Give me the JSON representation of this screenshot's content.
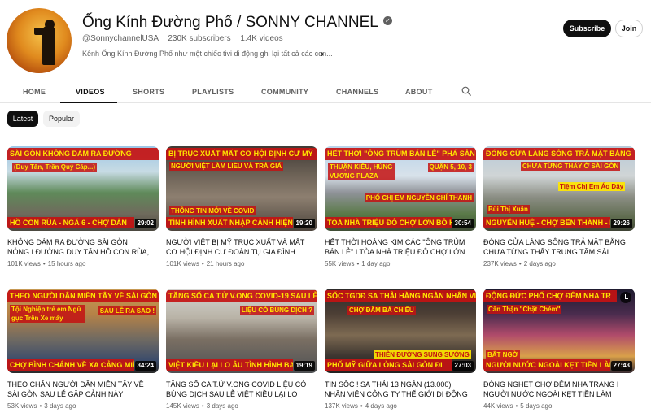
{
  "channel": {
    "name": "Ống Kính Đường Phố / SONNY CHANNEL",
    "handle": "@SonnychannelUSA",
    "subscribers": "230K subscribers",
    "videos_count": "1.4K videos",
    "description": "Kênh Ống Kính Đường Phố như một chiếc tivi di động ghi lại tất cả các con...",
    "subscribe_label": "Subscribe",
    "join_label": "Join"
  },
  "tabs": [
    {
      "label": "HOME"
    },
    {
      "label": "VIDEOS"
    },
    {
      "label": "SHORTS"
    },
    {
      "label": "PLAYLISTS"
    },
    {
      "label": "COMMUNITY"
    },
    {
      "label": "CHANNELS"
    },
    {
      "label": "ABOUT"
    }
  ],
  "filters": {
    "latest": "Latest",
    "popular": "Popular"
  },
  "videos": [
    {
      "thumb_top": "SÀI GÒN KHÔNG DÁM RA ĐƯỜNG",
      "thumb_sub": "(Duy Tân, Trần Quý Cáp...)",
      "thumb_bottom": "HỒ CON RÙA - NGÃ 6 - CHỢ DÂN",
      "duration": "29:02",
      "title": "KHÔNG DÁM RA ĐƯỜNG SÀI GÒN NÓNG I ĐƯỜNG DUY TÂN HỒ CON RÙA, TRẦN QUÝ...",
      "views": "101K views",
      "age": "15 hours ago"
    },
    {
      "thumb_top": "BỊ TRỤC XUẤT MẤT CƠ HỘI ĐỊNH CƯ MỸ",
      "thumb_sub": "NGƯỜI VIỆT LÀM LIỀU VÀ TRẢ GIÁ",
      "thumb_sub2": "THÔNG TIN MỚI VỀ COVID",
      "thumb_bottom": "TÌNH HÌNH XUẤT NHẬP CẢNH HIỆN",
      "duration": "19:20",
      "title": "NGƯỜI VIỆT BỊ MỸ TRỤC XUẤT VÀ MẤT CƠ HỘI ĐỊNH CƯ ĐOÀN TỤ GIA ĐÌNH",
      "views": "101K views",
      "age": "21 hours ago"
    },
    {
      "thumb_top": "HẾT THỜI \"ÔNG TRÙM BÁN LẺ\" PHÁ SẢN",
      "thumb_sub": "THUẬN KIỀU, HÙNG VƯƠNG PLAZA",
      "thumb_sub2": "QUẬN 5, 10, 3",
      "thumb_sub3": "PHỐ CHỊ EM NGUYỄN CHÍ THANH",
      "thumb_bottom": "TÒA NHÀ TRIỆU ĐÔ CHỢ LỚN BỎ H",
      "duration": "30:54",
      "title": "HẾT THỜI HOÀNG KIM CÁC \"ÔNG TRÙM BÁN LẺ\" I TÒA NHÀ TRIỆU ĐÔ CHỢ LỚN BỎ...",
      "views": "55K views",
      "age": "1 day ago"
    },
    {
      "thumb_top": "ĐÓNG CỬA LÀNG SÔNG TRẢ MẶT BẰNG",
      "thumb_sub": "CHƯA TỪNG THẤY Ở SÀI GÒN",
      "thumb_sub2": "Tiệm Chị Em Áo Dây",
      "thumb_sub3": "Bùi Thị Xuân",
      "thumb_bottom": "NGUYỄN HUỆ - CHỢ BẾN THÀNH - L",
      "duration": "29:26",
      "title": "ĐÓNG CỬA LÀNG SÔNG TRẢ MẶT BẰNG CHƯA TỪNG THẤY TRUNG TÂM SÀI GÒN",
      "views": "237K views",
      "age": "2 days ago"
    },
    {
      "thumb_top": "THEO NGƯỜI DÂN MIỀN TÂY VỀ SÀI GÒN",
      "thumb_sub": "Tội Nghiệp trẻ em Ngủ gục Trên Xe máy",
      "thumb_sub2": "SAU LỄ RA SAO !",
      "thumb_bottom": "CHỢ BÌNH CHÁNH VỀ XA CẢNG MIỀ",
      "duration": "34:24",
      "title": "THEO CHÂN NGƯỜI DÂN MIỀN TÂY VỀ SÀI GÒN SAU LỄ GẶP CẢNH NÀY",
      "views": "53K views",
      "age": "3 days ago"
    },
    {
      "thumb_top": "TĂNG SỐ CA T.Ử V.ONG COVID-19 SAU LỄ",
      "thumb_sub": "LIỆU CÓ BÙNG DỊCH ?",
      "thumb_bottom": "VIỆT KIỀU LẠI LO ÂU TÌNH HÌNH BAY QU",
      "duration": "19:19",
      "title": "TĂNG SỐ CA T.Ử V.ONG COVID LIỆU CÓ BÙNG DỊCH SAU LỄ VIỆT KIỀU LẠI LO",
      "views": "145K views",
      "age": "3 days ago"
    },
    {
      "thumb_top": "SỐC TGDĐ SA THẢI HÀNG NGÀN NHÂN VIÊN",
      "thumb_sub": "CHỢ ĐẦM BÀ CHIỂU",
      "thumb_sub2": "THIÊN ĐƯỜNG SUNG SƯỚNG",
      "thumb_bottom": "PHỐ MỸ GIỮA LÒNG SÀI GÒN ĐI",
      "duration": "27:03",
      "title": "TIN SỐC ! SA THẢI 13 NGÀN (13.000) NHÂN VIÊN CÔNG TY THẾ GIỚI DI ĐỘNG I PHỐ M...",
      "views": "137K views",
      "age": "4 days ago"
    },
    {
      "thumb_top": "ĐỘNG ĐỨC PHỐ CHỢ ĐÊM NHA TR",
      "thumb_sub": "Cẩn Thận \"Chặt Chém\"",
      "thumb_sub2": "BẤT NGỜ",
      "thumb_bottom": "NGƯỜI NƯỚC NGOÀI KẸT TIỀN LÀM KIẾM",
      "duration": "27:43",
      "title": "ĐÓNG NGHẸT CHỢ ĐÊM NHA TRANG I NGƯỜI NƯỚC NGOÀI KẸT TIỀN LÀM PHỤC...",
      "views": "44K views",
      "age": "5 days ago"
    }
  ],
  "colors": {
    "banner_red": "#c41212",
    "banner_yellow": "#ffe600",
    "text_primary": "#0f0f0f",
    "text_secondary": "#606060"
  }
}
